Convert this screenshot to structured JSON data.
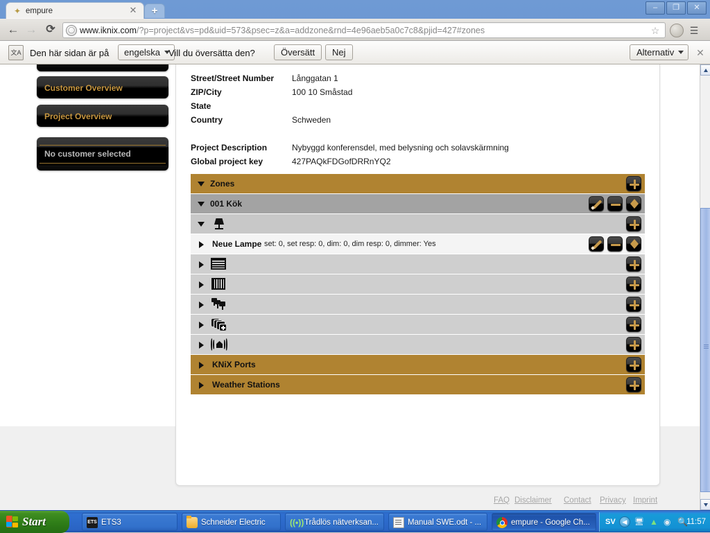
{
  "browser": {
    "tab": {
      "title": "empure",
      "favicon_icon": "empure-favicon",
      "close_icon": "close-icon"
    },
    "new_tab_icon": "plus-icon",
    "window_controls": {
      "minimize": "–",
      "maximize": "❐",
      "close": "✕"
    },
    "nav": {
      "back_icon": "←",
      "forward_icon": "→",
      "reload_icon": "⟳"
    },
    "omnibox": {
      "url_host": "www.iknix.com",
      "url_path": "/?p=project&vs=pd&uid=573&psec=z&a=addzone&rnd=4e96aeb5a0c7c8&pjid=427#zones",
      "globe_icon": "globe-icon",
      "star_icon": "☆"
    },
    "extension_icon": "extension-icon",
    "wrench_icon": "☰"
  },
  "translate_bar": {
    "icon": "translate-icon",
    "text_before": "Den här sidan är på",
    "language_value": "engelska",
    "text_after": "Vill du översätta den?",
    "translate_label": "Översätt",
    "decline_label": "Nej",
    "options_label": "Alternativ",
    "close_icon": "✕"
  },
  "sidebar": {
    "items": [
      {
        "label": "Customer Overview",
        "name": "customer-overview"
      },
      {
        "label": "Project Overview",
        "name": "project-overview"
      }
    ],
    "status": {
      "label": "No customer selected"
    }
  },
  "project_details": {
    "rows": [
      {
        "label": "Street/Street Number",
        "value": "Långgatan 1"
      },
      {
        "label": "ZIP/City",
        "value": "100 10 Småstad"
      },
      {
        "label": "State",
        "value": ""
      },
      {
        "label": "Country",
        "value": "Schweden"
      }
    ],
    "rows2": [
      {
        "label": "Project Description",
        "value": "Nybyggd konferensdel, med belysning och solavskärmning"
      },
      {
        "label": "Global project key",
        "value": "427PAQkFDGofDRRnYQ2"
      }
    ],
    "actions": [
      {
        "label": "delete",
        "icon": "minus-icon"
      },
      {
        "label": "select",
        "icon": "p-icon"
      }
    ]
  },
  "accordion": {
    "rows": [
      {
        "name": "zones-header",
        "title": "Zones",
        "meta": "",
        "style": "gold",
        "expanded": true,
        "indent": 0,
        "device_icon": "",
        "actions": [
          "add-icon"
        ]
      },
      {
        "name": "zone-001-kok",
        "title": "001 Kök",
        "meta": "",
        "style": "grey-dark",
        "expanded": true,
        "indent": 0,
        "device_icon": "",
        "actions": [
          "edit-icon",
          "delete-icon",
          "move-icon"
        ]
      },
      {
        "name": "lamps-group",
        "title": "",
        "meta": "",
        "style": "grey-mid",
        "expanded": true,
        "indent": 0,
        "device_icon": "lamp-icon",
        "actions": [
          "add-icon"
        ]
      },
      {
        "name": "device-neue-lampe",
        "title": "Neue Lampe",
        "meta": "set: 0, set resp: 0, dim: 0, dim resp: 0, dimmer: Yes",
        "style": "white",
        "expanded": false,
        "indent": 1,
        "device_icon": "",
        "actions": [
          "edit-icon",
          "delete-icon",
          "move-icon"
        ]
      },
      {
        "name": "blinds-group",
        "title": "",
        "meta": "",
        "style": "grey-lt",
        "expanded": false,
        "indent": 0,
        "device_icon": "blinds-icon",
        "actions": [
          "add-icon"
        ]
      },
      {
        "name": "shutters-group",
        "title": "",
        "meta": "",
        "style": "grey-lt",
        "expanded": false,
        "indent": 0,
        "device_icon": "shutter-icon",
        "actions": [
          "add-icon"
        ]
      },
      {
        "name": "scenes-group",
        "title": "",
        "meta": "",
        "style": "grey-lt",
        "expanded": false,
        "indent": 0,
        "device_icon": "scenes-icon",
        "actions": [
          "add-icon"
        ]
      },
      {
        "name": "groups-group",
        "title": "",
        "meta": "",
        "style": "grey-lt",
        "expanded": false,
        "indent": 0,
        "device_icon": "groups-icon",
        "actions": [
          "add-icon"
        ]
      },
      {
        "name": "sensors-group",
        "title": "",
        "meta": "",
        "style": "grey-lt",
        "expanded": false,
        "indent": 0,
        "device_icon": "presence-sensor-icon",
        "actions": [
          "add-icon"
        ]
      },
      {
        "name": "knix-ports",
        "title": "KNiX Ports",
        "meta": "",
        "style": "gold",
        "expanded": false,
        "indent": 0,
        "device_icon": "",
        "actions": [
          "add-icon"
        ]
      },
      {
        "name": "weather-stations",
        "title": "Weather Stations",
        "meta": "",
        "style": "gold",
        "expanded": false,
        "indent": 0,
        "device_icon": "",
        "actions": [
          "add-icon"
        ]
      }
    ]
  },
  "footer": {
    "links": [
      "FAQ",
      "Disclaimer",
      "Contact",
      "Privacy",
      "Imprint"
    ]
  },
  "taskbar": {
    "start_label": "Start",
    "buttons": [
      {
        "label": "ETS3",
        "icon": "ets3-icon",
        "active": false
      },
      {
        "label": "Schneider Electric",
        "icon": "folder-icon",
        "active": false
      },
      {
        "label": "Trådlös nätverksan...",
        "icon": "wifi-icon",
        "active": false
      },
      {
        "label": "Manual SWE.odt - ...",
        "icon": "document-icon",
        "active": false
      },
      {
        "label": "empure - Google Ch...",
        "icon": "chrome-icon",
        "active": true
      }
    ],
    "tray": {
      "language": "SV",
      "icons": [
        "show-hidden-icon",
        "network-icon",
        "signal-icon",
        "volume-icon",
        "device-icon"
      ],
      "clock": "11:57"
    }
  },
  "colors": {
    "gold": "#b08331",
    "accent_link": "#b2863b",
    "sidebar_text": "#c7963f",
    "chip_glyph": "#c89a4a"
  }
}
